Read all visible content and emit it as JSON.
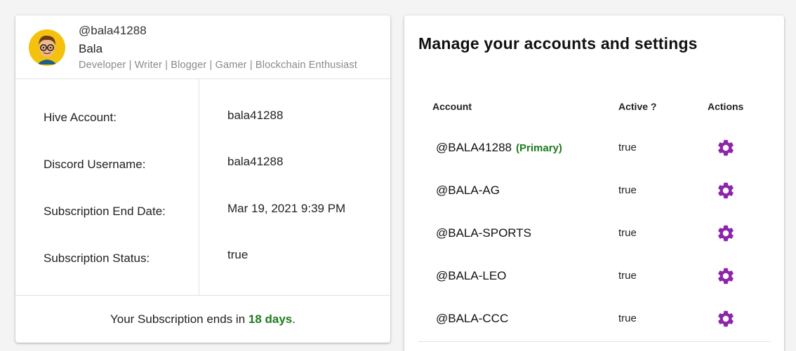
{
  "profile": {
    "handle": "@bala41288",
    "display_name": "Bala",
    "bio": "Developer | Writer | Blogger | Gamer | Blockchain Enthusiast",
    "avatar_icon": "cartoon-avatar-with-glasses"
  },
  "details": [
    {
      "label": "Hive Account:",
      "value": "bala41288"
    },
    {
      "label": "Discord Username:",
      "value": "bala41288"
    },
    {
      "label": "Subscription End Date:",
      "value": "Mar 19, 2021 9:39 PM"
    },
    {
      "label": "Subscription Status:",
      "value": "true"
    }
  ],
  "subscription": {
    "prefix": "Your Subscription ends in ",
    "days": "18 days",
    "suffix": "."
  },
  "accounts_panel": {
    "title": "Manage your accounts and settings",
    "columns": {
      "account": "Account",
      "active": "Active ?",
      "actions": "Actions"
    },
    "rows": [
      {
        "name": "@BALA41288",
        "tag": "(Primary)",
        "active": "true",
        "action_icon": "gear-icon"
      },
      {
        "name": "@BALA-AG",
        "active": "true",
        "action_icon": "gear-icon"
      },
      {
        "name": "@BALA-SPORTS",
        "active": "true",
        "action_icon": "gear-icon"
      },
      {
        "name": "@BALA-LEO",
        "active": "true",
        "action_icon": "gear-icon"
      },
      {
        "name": "@BALA-CCC",
        "active": "true",
        "action_icon": "gear-icon"
      }
    ]
  },
  "colors": {
    "accent_purple": "#8e24aa",
    "success_green": "#1e7b1e",
    "muted_text": "#8a8a8a"
  }
}
